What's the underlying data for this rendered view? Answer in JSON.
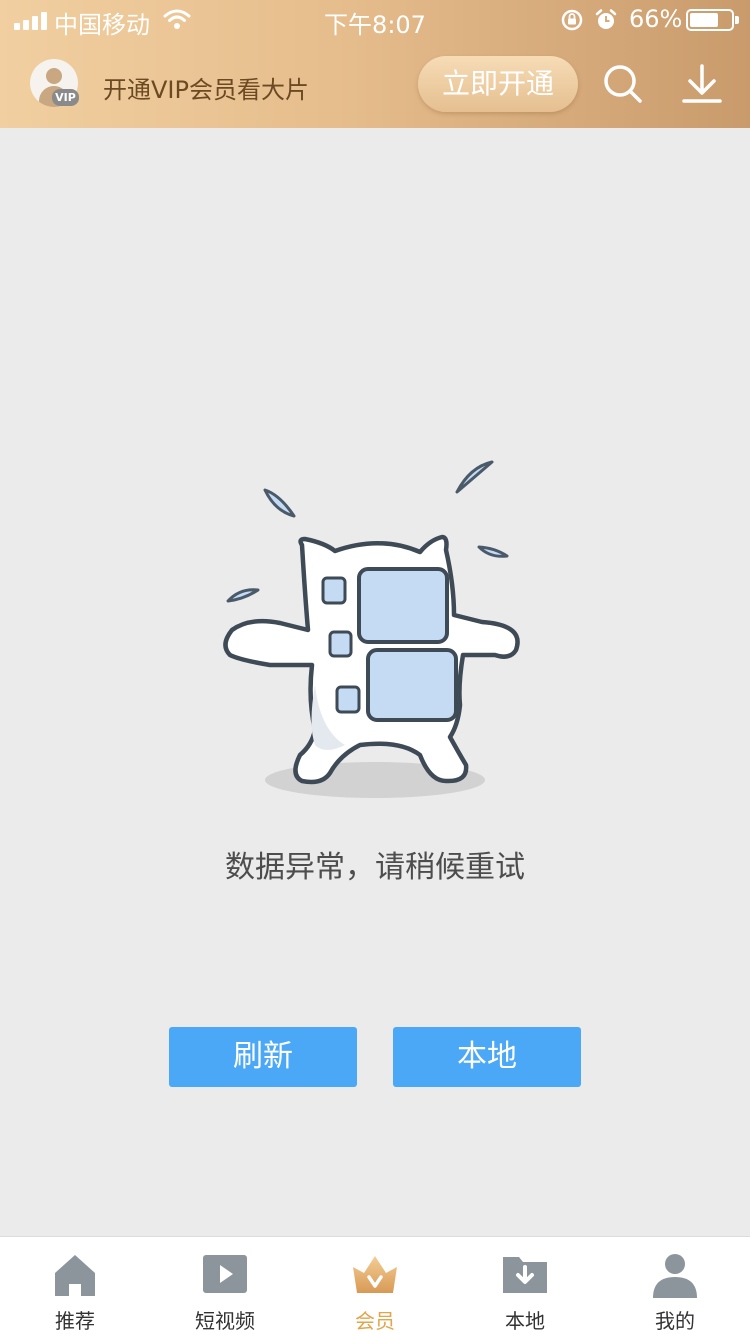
{
  "status_bar": {
    "carrier": "中国移动",
    "time": "下午8:07",
    "battery_percent": "66%",
    "battery_level": 0.66
  },
  "header": {
    "vip_badge": "VIP",
    "promo_text": "开通VIP会员看大片",
    "open_button": "立即开通",
    "icons": [
      "search-icon",
      "download-icon"
    ],
    "gradient_colors": [
      "#f1cfa0",
      "#c99b6c"
    ]
  },
  "main": {
    "error_message": "数据异常，请稍候重试",
    "refresh_button": "刷新",
    "local_button": "本地",
    "button_color": "#4aa8f7"
  },
  "tabbar": {
    "active_color": "#e1a64c",
    "tabs": [
      {
        "label": "推荐",
        "icon": "home-icon"
      },
      {
        "label": "短视频",
        "icon": "play-icon"
      },
      {
        "label": "会员",
        "icon": "crown-icon",
        "active": true
      },
      {
        "label": "本地",
        "icon": "folder-download-icon"
      },
      {
        "label": "我的",
        "icon": "person-icon"
      }
    ]
  }
}
